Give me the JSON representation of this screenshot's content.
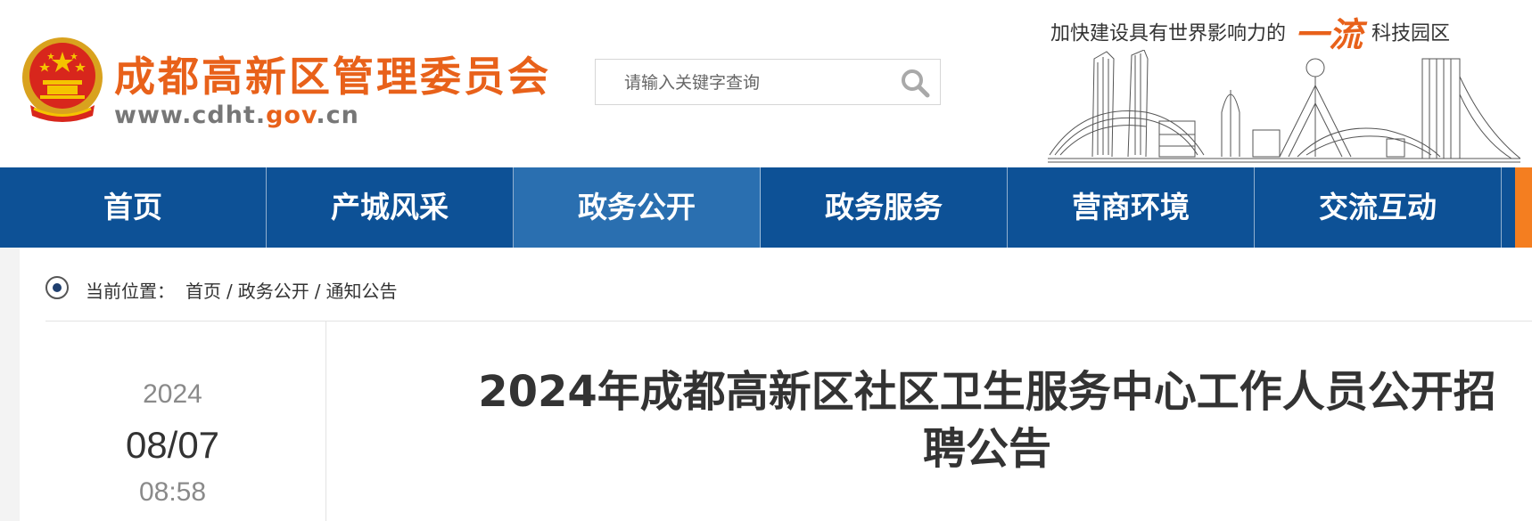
{
  "header": {
    "site_title": "成都高新区管理委员会",
    "url_prefix": "www.cdht.",
    "url_highlight": "gov",
    "url_suffix": ".cn",
    "slogan_before": "加快建设具有世界影响力的",
    "slogan_big": "一流",
    "slogan_after": "科技园区"
  },
  "search": {
    "placeholder": "请输入关键字查询",
    "value": ""
  },
  "nav": {
    "items": [
      "首页",
      "产城风采",
      "政务公开",
      "政务服务",
      "营商环境",
      "交流互动"
    ],
    "active_index": 2
  },
  "breadcrumb": {
    "label": "当前位置：",
    "items": [
      "首页",
      "政务公开",
      "通知公告"
    ],
    "separator": "/"
  },
  "article": {
    "year": "2024",
    "date": "08/07",
    "time": "08:58",
    "title": "2024年成都高新区社区卫生服务中心工作人员公开招聘公告"
  },
  "colors": {
    "brand_orange": "#e8611a",
    "nav_blue": "#0d5196",
    "nav_active": "#2a6fb0",
    "nav_end_accent": "#f47e20"
  },
  "icons": {
    "emblem": "national-emblem",
    "search": "search-icon",
    "breadcrumb": "location-icon"
  }
}
